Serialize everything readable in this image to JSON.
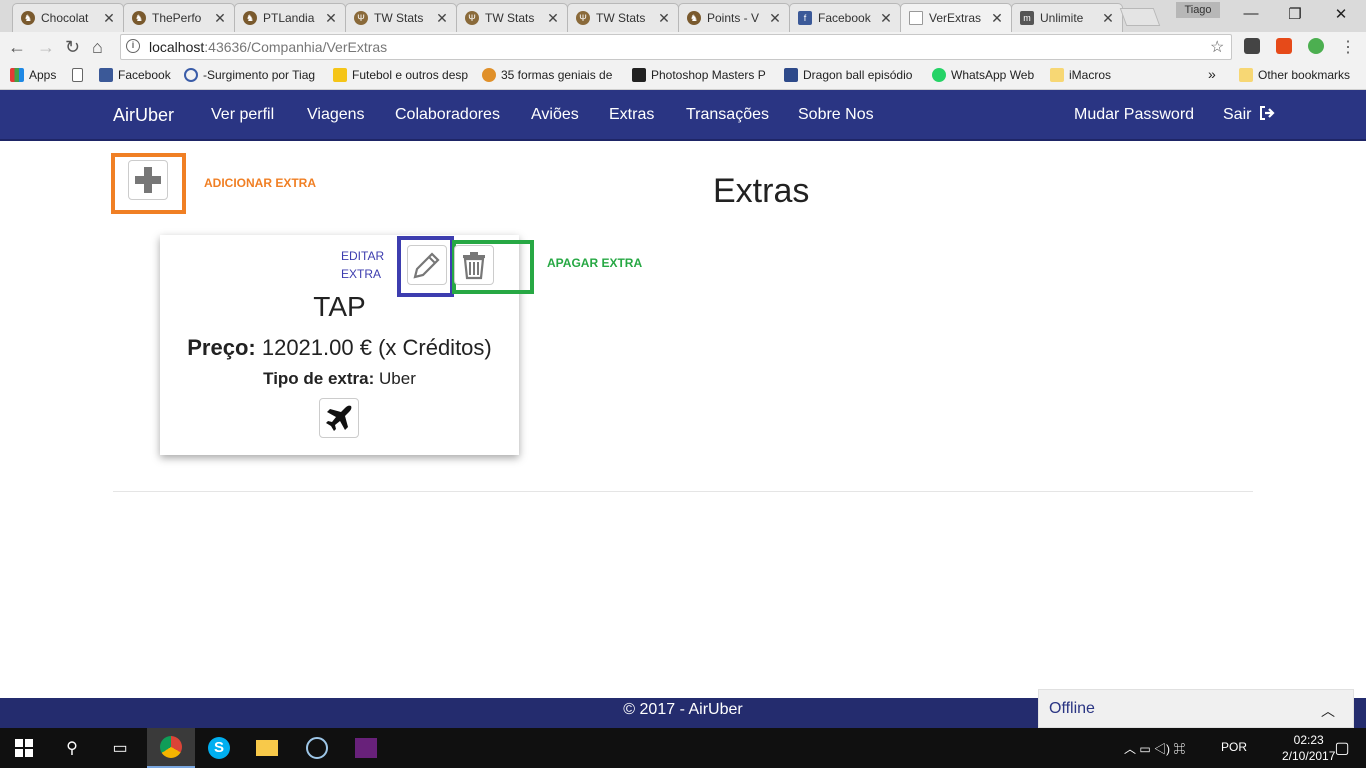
{
  "browser": {
    "tabs": [
      {
        "label": "Chocolat",
        "active": false
      },
      {
        "label": "ThePerfo",
        "active": false
      },
      {
        "label": "PTLandia",
        "active": false
      },
      {
        "label": "TW Stats",
        "active": false
      },
      {
        "label": "TW Stats",
        "active": false
      },
      {
        "label": "TW Stats",
        "active": false
      },
      {
        "label": "Points - V",
        "active": false
      },
      {
        "label": "Facebook",
        "active": false
      },
      {
        "label": "VerExtras",
        "active": true
      },
      {
        "label": "Unlimite",
        "active": false
      }
    ],
    "profile": "Tiago",
    "url_host": "localhost",
    "url_path": ":43636/Companhia/VerExtras",
    "bookmarks": [
      "Apps",
      "Facebook",
      "-Surgimento por Tiag",
      "Futebol e outros desp",
      "35 formas geniais de",
      "Photoshop Masters P",
      "Dragon ball episódio",
      "WhatsApp Web",
      "iMacros"
    ],
    "more_bookmarks": "»",
    "other_bookmarks": "Other bookmarks"
  },
  "navbar": {
    "brand": "AirUber",
    "links": [
      "Ver perfil",
      "Viagens",
      "Colaboradores",
      "Aviões",
      "Extras",
      "Transações",
      "Sobre Nos"
    ],
    "right": [
      "Mudar Password",
      "Sair"
    ]
  },
  "page": {
    "title": "Extras",
    "add_label": "ADICIONAR EXTRA",
    "edit_label": "EDITAR EXTRA",
    "delete_label": "APAGAR EXTRA"
  },
  "card": {
    "name": "TAP",
    "price_label": "Preço:",
    "price_value": "12021.00 € (x Créditos)",
    "type_label": "Tipo de extra:",
    "type_value": "Uber"
  },
  "footer": {
    "text": "© 2017 - AirUber"
  },
  "offline": {
    "label": "Offline"
  },
  "taskbar": {
    "lang": "POR",
    "time": "02:23",
    "date": "2/10/2017"
  },
  "colors": {
    "navbar": "#2a3583",
    "add": "#f07f24",
    "edit": "#3d3daf",
    "delete": "#27a844"
  }
}
